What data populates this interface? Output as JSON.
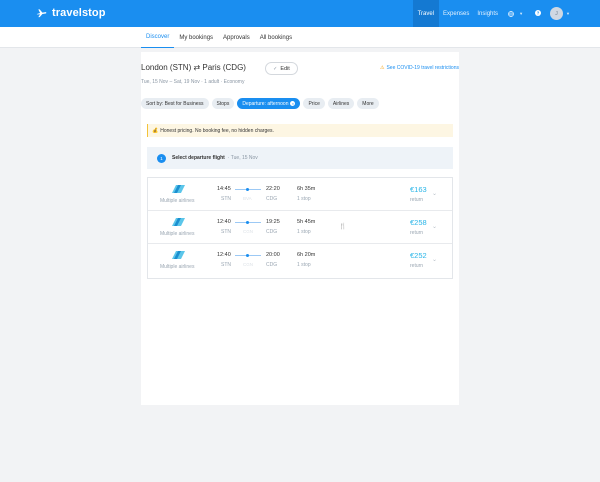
{
  "app": {
    "brand": "travelstop",
    "nav": [
      {
        "label": "Travel",
        "active": true
      },
      {
        "label": "Expenses",
        "active": false
      },
      {
        "label": "Insights",
        "active": false
      }
    ],
    "help_glyph": "?",
    "avatar_initial": "J"
  },
  "tabs": [
    {
      "label": "Discover",
      "active": true
    },
    {
      "label": "My bookings",
      "active": false
    },
    {
      "label": "Approvals",
      "active": false
    },
    {
      "label": "All bookings",
      "active": false
    }
  ],
  "search": {
    "route": "London (STN) ⇄ Paris (CDG)",
    "edit_label": "Edit",
    "covid_link": "See COVID-19 travel restrictions",
    "meta": "Tue, 15 Nov – Sat, 19 Nov  ·  1 adult  ·  Economy"
  },
  "filters": [
    {
      "label": "Sort by: Best for Business",
      "active": false
    },
    {
      "label": "Stops",
      "active": false
    },
    {
      "label": "Departure: afternoon",
      "active": true
    },
    {
      "label": "Price",
      "active": false
    },
    {
      "label": "Airlines",
      "active": false
    },
    {
      "label": "More",
      "active": false
    }
  ],
  "notice": "Honest pricing. No booking fee, no hidden charges.",
  "select_flight": {
    "step": "1",
    "title": "Select departure flight",
    "date": "·  Tue, 15 Nov"
  },
  "flights": [
    {
      "airline": "Multiple airlines",
      "dep_time": "14:45",
      "dep_code": "STN",
      "via": "BVA",
      "arr_time": "22:20",
      "arr_code": "CDG",
      "duration": "6h 35m",
      "stops": "1 stop",
      "amenity": "",
      "price": "€163",
      "price_note": "return"
    },
    {
      "airline": "Multiple airlines",
      "dep_time": "12:40",
      "dep_code": "STN",
      "via": "CGN",
      "arr_time": "19:25",
      "arr_code": "CDG",
      "duration": "5h 45m",
      "stops": "1 stop",
      "amenity": "dining-icon",
      "price": "€258",
      "price_note": "return"
    },
    {
      "airline": "Multiple airlines",
      "dep_time": "12:40",
      "dep_code": "STN",
      "via": "CGN",
      "arr_time": "20:00",
      "arr_code": "CDG",
      "duration": "6h 20m",
      "stops": "1 stop",
      "amenity": "",
      "price": "€252",
      "price_note": "return"
    }
  ],
  "colors": {
    "brand": "#1a8ef0",
    "price": "#29b5e8",
    "notice_bg": "#fdf6e3"
  }
}
